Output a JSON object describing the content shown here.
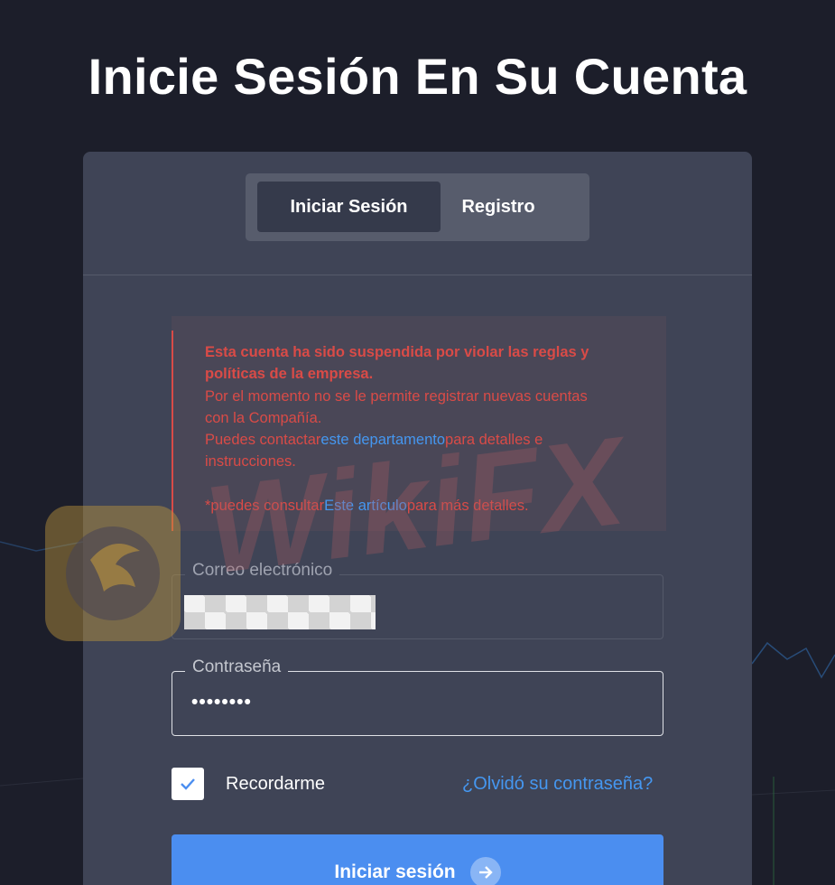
{
  "page": {
    "title": "Inicie Sesión En Su Cuenta"
  },
  "tabs": [
    {
      "label": "Iniciar Sesión",
      "active": true
    },
    {
      "label": "Registro",
      "active": false
    }
  ],
  "alert": {
    "line1": "Esta cuenta ha sido suspendida por violar las reglas y",
    "line2": "políticas de la empresa.",
    "line3": "Por el momento no se le permite registrar nuevas cuentas",
    "line4": "con la Compañía.",
    "line5_before": "Puedes contactar",
    "line5_link": "este departamento",
    "line5_after": "para detalles e",
    "line6": "instrucciones.",
    "line7_before": "*puedes consultar",
    "line7_link": "Este artículo",
    "line7_after": "para más detalles."
  },
  "form": {
    "email_label": "Correo electrónico",
    "password_label": "Contraseña",
    "password_value": "••••••••",
    "remember_label": "Recordarme",
    "remember_checked": true,
    "forgot_link": "¿Olvidó su contraseña?",
    "submit_label": "Iniciar sesión"
  },
  "watermark": {
    "text": "WikiFX"
  },
  "colors": {
    "background": "#1c1e2a",
    "card": "#3f4456",
    "error": "#d94b47",
    "link": "#4597f0",
    "primary_button": "#4b8ef0"
  }
}
